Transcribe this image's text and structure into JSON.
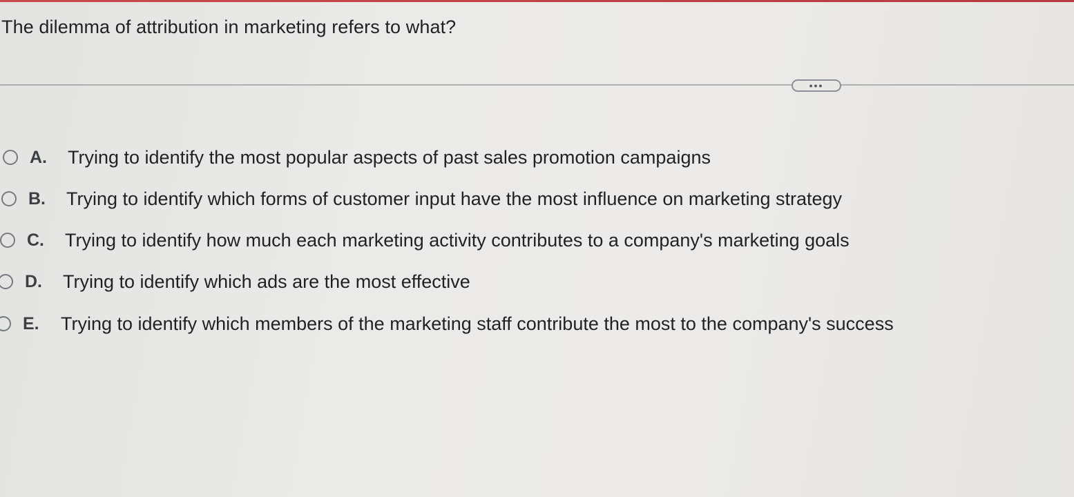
{
  "question": {
    "text": "The dilemma of attribution in marketing refers to what?"
  },
  "more_button": {
    "label": "•••"
  },
  "options": [
    {
      "letter": "A.",
      "text": "Trying to identify the most popular aspects of past sales promotion campaigns",
      "selected": false
    },
    {
      "letter": "B.",
      "text": "Trying to identify which forms of customer input have the most influence on marketing strategy",
      "selected": false
    },
    {
      "letter": "C.",
      "text": "Trying to identify how much each marketing activity contributes to a company's marketing goals",
      "selected": false
    },
    {
      "letter": "D.",
      "text": "Trying to identify which ads are the most effective",
      "selected": false
    },
    {
      "letter": "E.",
      "text": "Trying to identify which members of the marketing staff contribute the most to the company's success",
      "selected": false
    }
  ]
}
